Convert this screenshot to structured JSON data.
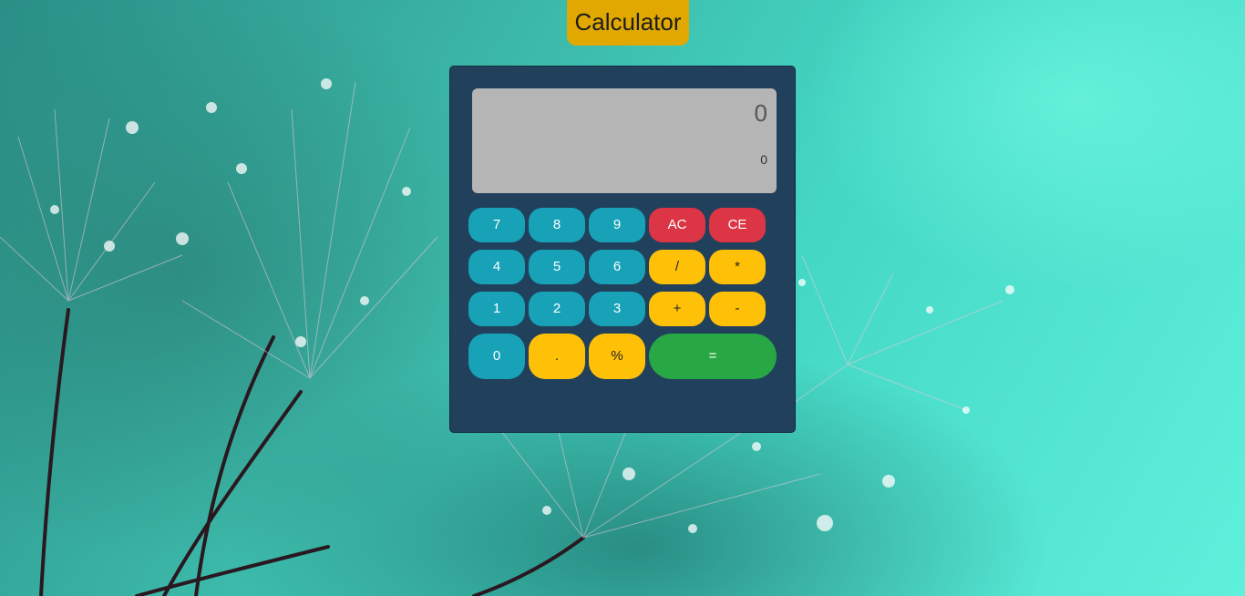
{
  "header": {
    "title": "Calculator"
  },
  "display": {
    "main_value": "0",
    "sub_value": "0"
  },
  "keypad": {
    "row1": [
      "7",
      "8",
      "9",
      "AC",
      "CE"
    ],
    "row2": [
      "4",
      "5",
      "6",
      "/",
      "*"
    ],
    "row3": [
      "1",
      "2",
      "3",
      "+",
      "-"
    ],
    "row4": [
      "0",
      ".",
      "%",
      "="
    ]
  },
  "colors": {
    "title_badge": "#e0a800",
    "calculator_body": "#21405c",
    "display": "#b5b5b5",
    "number_button": "#17a2b8",
    "clear_button": "#dc3545",
    "operator_button": "#ffc107",
    "equals_button": "#28a745"
  }
}
